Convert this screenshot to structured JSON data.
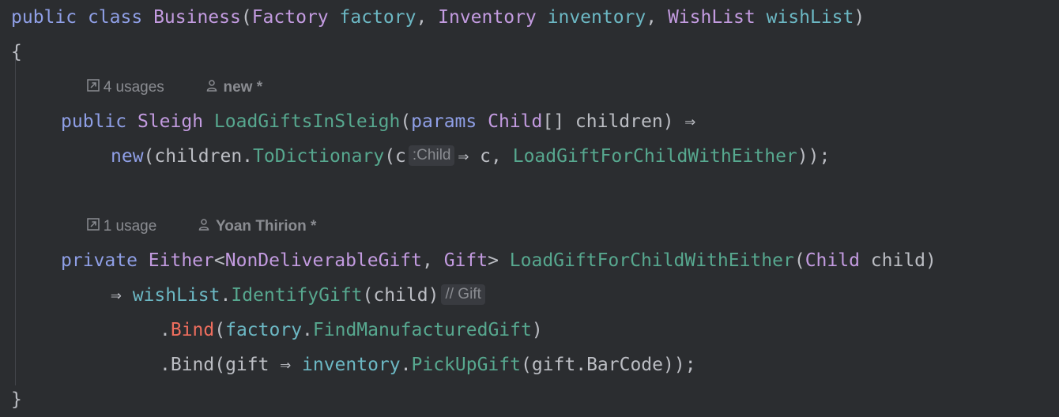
{
  "code": {
    "line1": {
      "kw1": "public",
      "kw2": "class",
      "cls": "Business",
      "open": "(",
      "t1": "Factory",
      "p1": "factory",
      "c1": ", ",
      "t2": "Inventory",
      "p2": "inventory",
      "c2": ", ",
      "t3": "WishList",
      "p3": "wishList",
      "close": ")"
    },
    "line2": {
      "brace": "{"
    },
    "lens1": {
      "usages": "4 usages",
      "author": "new *"
    },
    "line3": {
      "kw": "public",
      "ret": "Sleigh",
      "name": "LoadGiftsInSleigh",
      "open": "(",
      "kwp": "params",
      "type": "Child",
      "arr": "[] children) ⇒"
    },
    "line4": {
      "kw": "new",
      "a": "(children.",
      "m": "ToDictionary",
      "b": "(c",
      "hint": ":Child",
      "c": "⇒ c, ",
      "ref": "LoadGiftForChildWithEither",
      "d": "));"
    },
    "lens2": {
      "usages": "1 usage",
      "author": "Yoan Thirion *"
    },
    "line5": {
      "kw": "private",
      "ret": "Either",
      "lt": "<",
      "t1": "NonDeliverableGift",
      "comma": ", ",
      "t2": "Gift",
      "gt": "> ",
      "name": "LoadGiftForChildWithEither",
      "open": "(",
      "ptype": "Child",
      "pname": " child)"
    },
    "line6": {
      "arrow": "⇒ ",
      "obj": "wishList",
      "dot": ".",
      "m": "IdentifyGift",
      "args": "(child)",
      "hint": "// Gift"
    },
    "line7": {
      "dot": ".",
      "m": "Bind",
      "open": "(",
      "obj": "factory",
      "dot2": ".",
      "ref": "FindManufacturedGift",
      "close": ")"
    },
    "line8": {
      "a": ".Bind(gift ⇒ ",
      "obj": "inventory",
      "dot": ".",
      "m": "PickUpGift",
      "b": "(gift.BarCode));"
    },
    "line9": {
      "brace": "}"
    }
  },
  "colors": {
    "background": "#2b2d30",
    "keyword": "#8f9fe6",
    "type": "#c39be0",
    "parameter": "#6cb8c4",
    "method": "#57a88f",
    "extension_method": "#ef6e5e",
    "text": "#bcbec4",
    "hint": "#8a8c91"
  },
  "icons": {
    "usages": "usages-link-icon",
    "author": "person-icon"
  }
}
